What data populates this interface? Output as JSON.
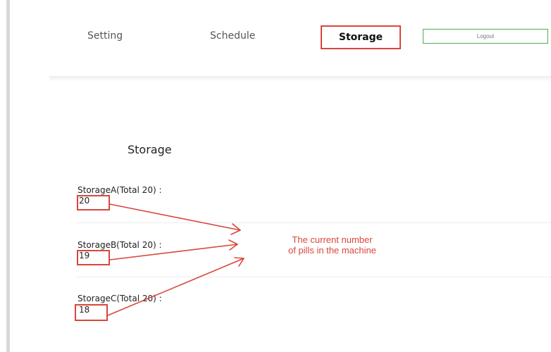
{
  "nav": {
    "items": [
      {
        "label": "Setting"
      },
      {
        "label": "Schedule"
      },
      {
        "label": "Storage",
        "active": true
      }
    ],
    "logout_label": "Logout"
  },
  "page": {
    "title": "Storage"
  },
  "storage": [
    {
      "label": "StorageA(Total 20) :",
      "value": "20"
    },
    {
      "label": "StorageB(Total 20) :",
      "value": "19"
    },
    {
      "label": "StorageC(Total 20) :",
      "value": "18"
    }
  ],
  "annotation": {
    "line1": "The current number",
    "line2": "of pills in the machine"
  },
  "colors": {
    "highlight": "#d9463b",
    "logout_border": "#4caf50"
  }
}
